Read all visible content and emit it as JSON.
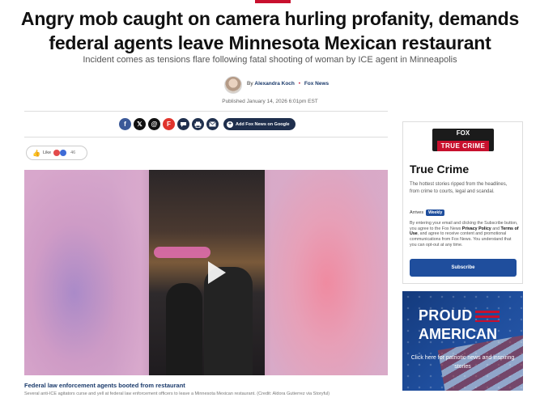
{
  "article": {
    "headline": "Angry mob caught on camera hurling profanity, demands federal agents leave Minnesota Mexican restaurant",
    "subheadline": "Incident comes as tensions flare following fatal shooting of woman by ICE agent in Minneapolis",
    "byline_prefix": "By",
    "author": "Alexandra Koch",
    "outlet": "Fox News",
    "published": "Published January 14, 2026 6:01pm EST"
  },
  "share": {
    "icons": [
      {
        "name": "facebook-icon",
        "glyph": "f"
      },
      {
        "name": "x-icon",
        "glyph": "𝕏"
      },
      {
        "name": "threads-icon",
        "glyph": "@"
      },
      {
        "name": "flipboard-icon",
        "glyph": "F"
      },
      {
        "name": "comments-icon",
        "glyph": "💬"
      },
      {
        "name": "print-icon",
        "glyph": "⎙"
      },
      {
        "name": "email-icon",
        "glyph": "✉"
      }
    ],
    "google_news_label": "Add Fox News on Google",
    "google_plus": "+"
  },
  "reactions": {
    "like_label": "Like",
    "count": "46"
  },
  "video": {
    "caption_title": "Federal law enforcement agents booted from restaurant",
    "caption_text": "Several anti-ICE agitators curse and yell at federal law enforcement officers to leave a Minnesota Mexican restaurant. (Credit: Aldora Gutierrez via Storyful)"
  },
  "newsletter": {
    "logo_fox": "FOX",
    "logo_label": "TRUE CRIME",
    "title": "True Crime",
    "description": "The hottest stories ripped from the headlines, from crime to courts, legal and scandal.",
    "arrives_label": "Arrives",
    "arrives_value": "Weekly",
    "legal_1": "By entering your email and clicking the Subscribe button, you agree to the Fox News ",
    "privacy_link": "Privacy Policy",
    "legal_and": " and ",
    "terms_link": "Terms of Use",
    "legal_2": ", and agree to receive content and promotional communications from Fox News. You understand that you can opt-out at any time.",
    "subscribe_label": "Subscribe"
  },
  "promo": {
    "line1": "PROUD",
    "line2": "AMERICAN",
    "tagline": "Click here for patriotic news and inspiring stories"
  },
  "colors": {
    "accent_red": "#c8102e",
    "navy": "#1f2f4d",
    "button_blue": "#1f4e9d"
  }
}
